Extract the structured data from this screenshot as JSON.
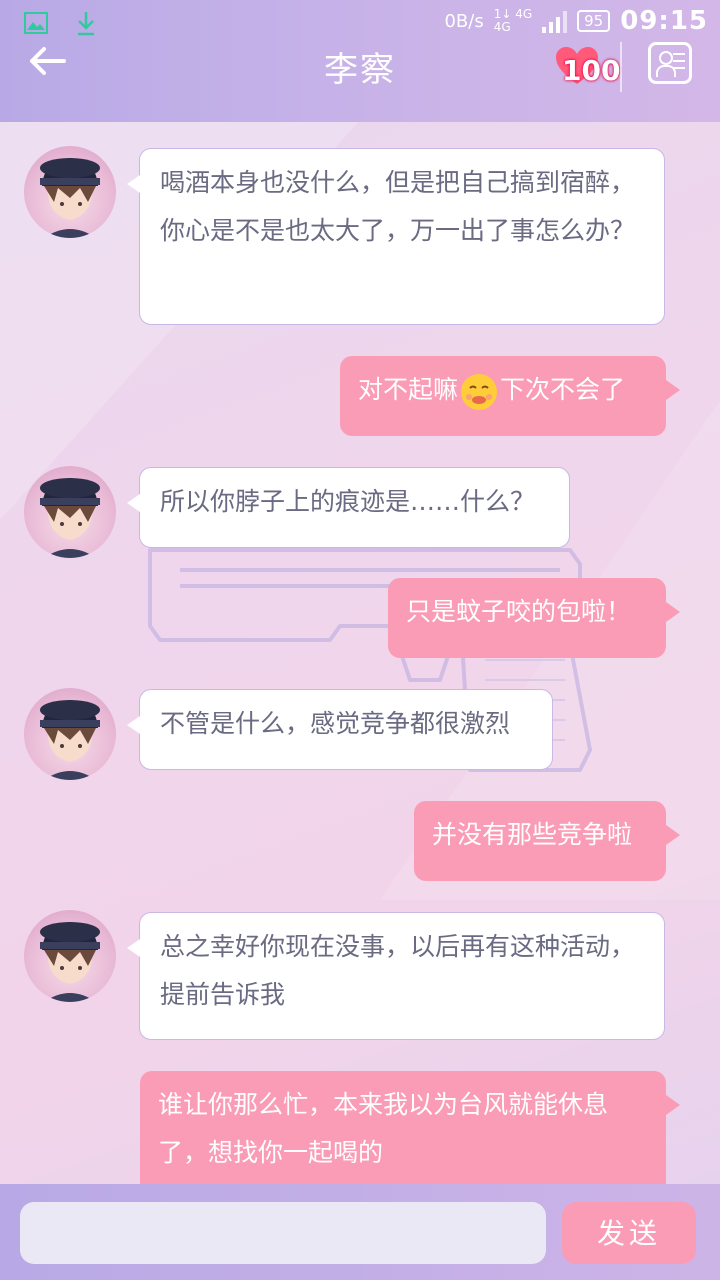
{
  "status_bar": {
    "net_speed": "0B/s",
    "signal_top": "1↓ 4G",
    "signal_bottom": "4G",
    "battery": "95",
    "time": "09:15"
  },
  "header": {
    "back_icon": "arrow-left-icon",
    "title": "李察",
    "affection": "100",
    "contact_icon": "contact-card-icon"
  },
  "messages": [
    {
      "from": "other",
      "text": "喝酒本身也没什么，但是把自己搞到宿醉，你心是不是也太大了，万一出了事怎么办？"
    },
    {
      "from": "me",
      "text_before": "对不起嘛",
      "emoji": "embarrassed-face-emoji",
      "text_after": "下次不会了"
    },
    {
      "from": "other",
      "text": "所以你脖子上的痕迹是……什么？"
    },
    {
      "from": "me",
      "text": "只是蚊子咬的包啦！"
    },
    {
      "from": "other",
      "text": "不管是什么，感觉竞争都很激烈"
    },
    {
      "from": "me",
      "text": "并没有那些竞争啦"
    },
    {
      "from": "other",
      "text": "总之幸好你现在没事，以后再有这种活动，提前告诉我"
    },
    {
      "from": "me",
      "text": "谁让你那么忙，本来我以为台风就能休息了，想找你一起喝的"
    }
  ],
  "input": {
    "value": "",
    "send_label": "发送"
  },
  "colors": {
    "header_start": "#b8a9e6",
    "header_end": "#d3b7e8",
    "my_bubble": "#fa9cb5",
    "other_bubble": "#ffffff",
    "other_text": "#6a6a82"
  }
}
